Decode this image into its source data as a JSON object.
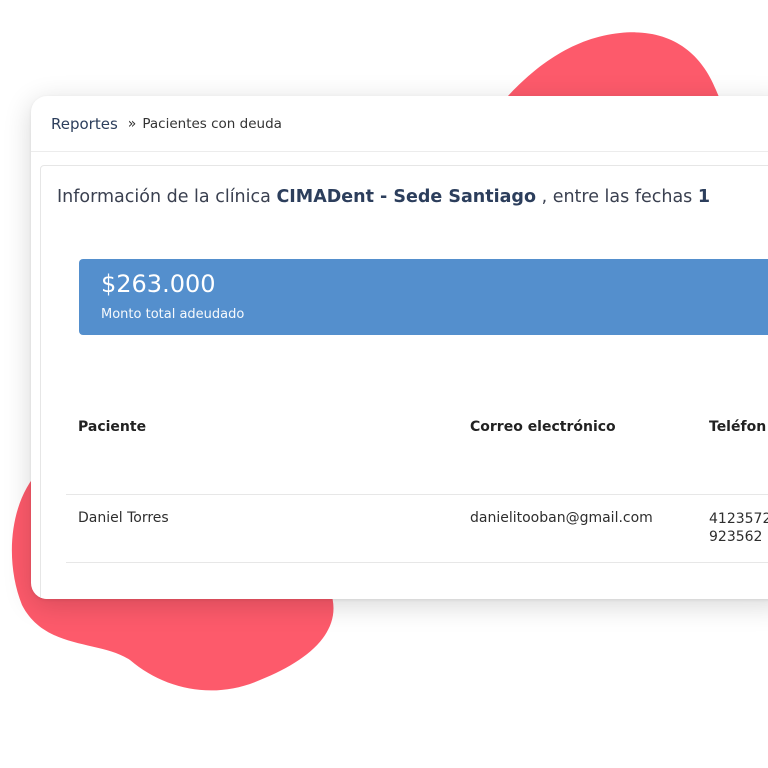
{
  "breadcrumb": {
    "root": "Reportes",
    "separator": "»",
    "current": "Pacientes con deuda"
  },
  "info": {
    "prefix": "Información de la clínica",
    "clinic": "CIMADent - Sede Santiago",
    "suffix": ", entre las fechas",
    "date_start": "1"
  },
  "summary": {
    "amount": "$263.000",
    "label": "Monto total adeudado"
  },
  "table": {
    "headers": [
      "Paciente",
      "Correo electrónico",
      "Teléfon"
    ],
    "rows": [
      {
        "paciente": "Daniel Torres",
        "correo": "danielitooban@gmail.com",
        "telefono_1": "4123572",
        "telefono_2": "923562"
      }
    ]
  },
  "colors": {
    "accent_blob": "#fd5a6b",
    "summary_bg": "#548fcd",
    "brand_text": "#2c3e5c"
  }
}
